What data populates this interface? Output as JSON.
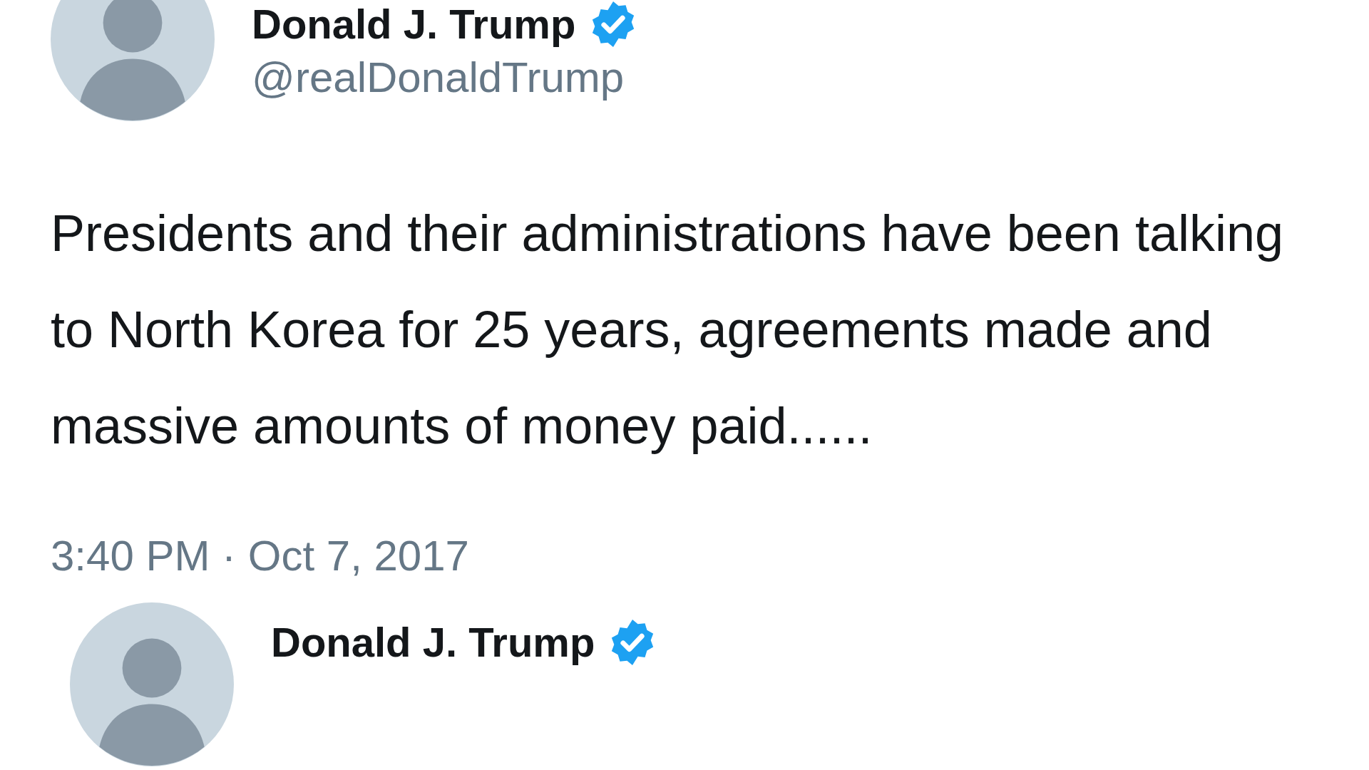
{
  "tweets": [
    {
      "name": "Donald J. Trump",
      "verified": true,
      "handle": "@realDonaldTrump",
      "text": "Presidents and their administrations have been talking to North Korea for 25 years, agreements made and massive amounts of money paid......",
      "timestamp": "3:40 PM · Oct 7, 2017"
    },
    {
      "name": "Donald J. Trump",
      "verified": true
    }
  ]
}
